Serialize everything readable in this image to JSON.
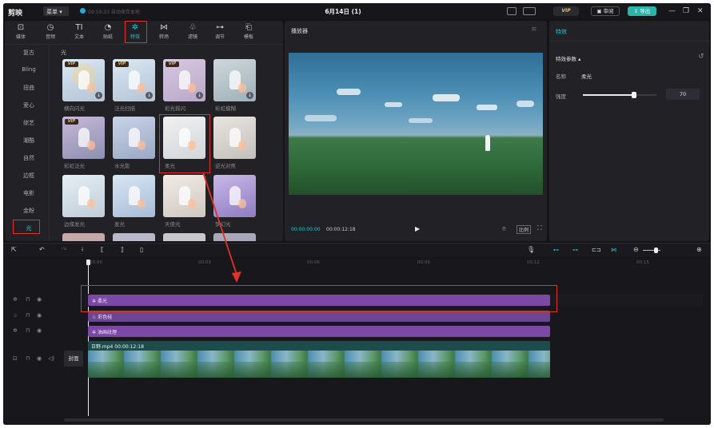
{
  "titlebar": {
    "logo": "剪映",
    "menu": "菜单",
    "autosave": "09:59:23 自动保存本地",
    "title": "6月14日 (1)",
    "vip": "VIP",
    "review": "审阅",
    "export": "导出"
  },
  "toolbar": [
    {
      "label": "媒体",
      "icon": "media-icon"
    },
    {
      "label": "音频",
      "icon": "audio-icon"
    },
    {
      "label": "文本",
      "icon": "text-icon"
    },
    {
      "label": "贴纸",
      "icon": "sticker-icon"
    },
    {
      "label": "特效",
      "icon": "effects-icon",
      "active": true
    },
    {
      "label": "转场",
      "icon": "transition-icon"
    },
    {
      "label": "滤镜",
      "icon": "filter-icon"
    },
    {
      "label": "调节",
      "icon": "adjust-icon"
    },
    {
      "label": "模板",
      "icon": "template-icon"
    }
  ],
  "categories": [
    "复古",
    "Bling",
    "扭曲",
    "爱心",
    "综艺",
    "潮酷",
    "自然",
    "边框",
    "电影",
    "金粉",
    "光"
  ],
  "active_category": "光",
  "section_title": "光",
  "effects": [
    {
      "name": "横向闪光",
      "vip": true
    },
    {
      "name": "泛光扫描",
      "vip": true
    },
    {
      "name": "彩光摇闪",
      "vip": true
    },
    {
      "name": "彩虹模糊",
      "vip": false
    },
    {
      "name": "彩虹泛光",
      "vip": true
    },
    {
      "name": "水光影",
      "vip": false
    },
    {
      "name": "柔光",
      "vip": false
    },
    {
      "name": "逆光对焦",
      "vip": false
    },
    {
      "name": "边缘发光",
      "vip": false
    },
    {
      "name": "发光",
      "vip": false
    },
    {
      "name": "天使光",
      "vip": false
    },
    {
      "name": "梦幻光",
      "vip": false
    }
  ],
  "player": {
    "title": "播放器",
    "current_time": "00:00:00:00",
    "total_time": "00:00:12:18",
    "ratio": "比例"
  },
  "inspector": {
    "title": "特效",
    "section": "特效参数",
    "name_label": "名称",
    "name_value": "柔光",
    "intensity_label": "强度",
    "intensity_value": "70",
    "intensity_fraction": 0.7
  },
  "timeline": {
    "ruler": [
      "00:00",
      "00:03",
      "00:06",
      "00:09",
      "00:12",
      "00:15"
    ],
    "clips": [
      {
        "label": "柔光"
      },
      {
        "label": "彩色硅"
      },
      {
        "label": "油画纹理"
      }
    ],
    "video_clip": "日野.mp4  00:00:12:18",
    "cover_label": "封面"
  },
  "colors": {
    "accent": "#2bc3d0",
    "highlight": "#e0312c",
    "clip": "#7b48a6"
  }
}
